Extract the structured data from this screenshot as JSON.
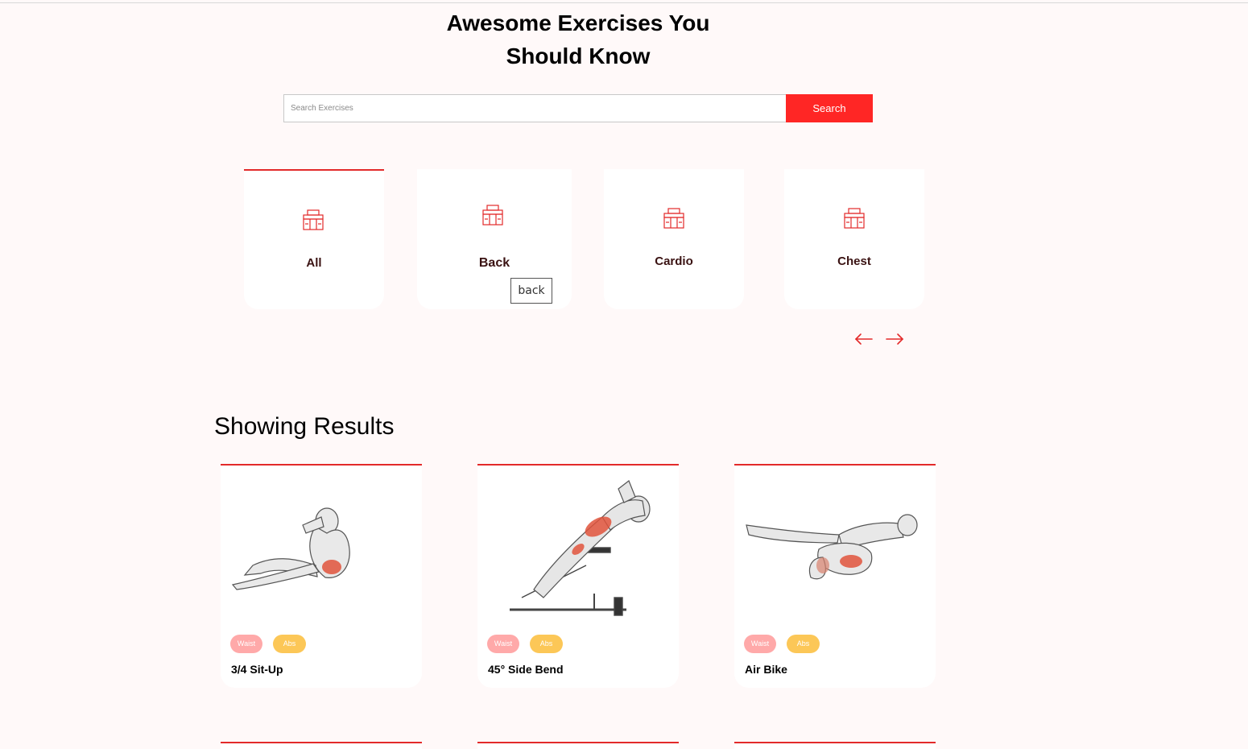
{
  "header": {
    "title_line1": "Awesome Exercises You",
    "title_line2": "Should Know"
  },
  "search": {
    "placeholder": "Search Exercises",
    "value": "",
    "button_label": "Search"
  },
  "categories": [
    {
      "label": "All",
      "icon": "gym-icon",
      "active": true
    },
    {
      "label": "Back",
      "icon": "gym-icon",
      "active": false
    },
    {
      "label": "Cardio",
      "icon": "gym-icon",
      "active": false
    },
    {
      "label": "Chest",
      "icon": "gym-icon",
      "active": false
    }
  ],
  "tooltip": {
    "text": "back"
  },
  "carousel": {
    "prev_icon": "arrow-left-icon",
    "next_icon": "arrow-right-icon"
  },
  "results": {
    "title": "Showing Results",
    "cards": [
      {
        "name": "3/4 Sit-Up",
        "tags": [
          "Waist",
          "Abs"
        ]
      },
      {
        "name": "45° Side Bend",
        "tags": [
          "Waist",
          "Abs"
        ]
      },
      {
        "name": "Air Bike",
        "tags": [
          "Waist",
          "Abs"
        ]
      }
    ]
  },
  "colors": {
    "accent": "#ff2625",
    "tag_bodypart": "#ffa9a9",
    "tag_target": "#fcc757",
    "background": "#fff9f9"
  }
}
